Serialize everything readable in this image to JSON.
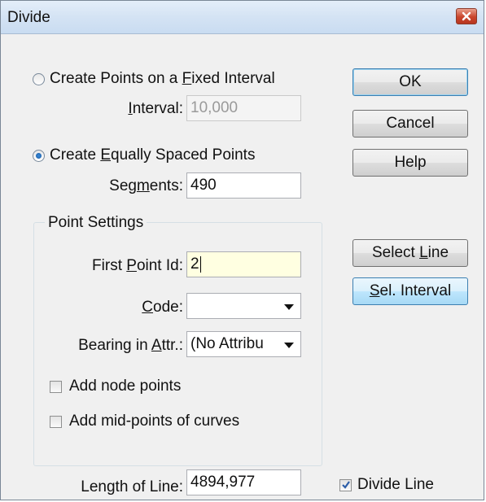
{
  "window": {
    "title": "Divide"
  },
  "fixed_interval": {
    "option_pre": "Create Points on a ",
    "option_key": "F",
    "option_post": "ixed  Interval",
    "interval_key": "I",
    "interval_label_post": "nterval:",
    "interval_value": "10,000",
    "selected": false
  },
  "equal_spacing": {
    "option_pre": "Create ",
    "option_key": "E",
    "option_post": "qually Spaced Points",
    "segments_pre": "Seg",
    "segments_key": "m",
    "segments_post": "ents:",
    "segments_value": "490",
    "selected": true
  },
  "point_settings": {
    "title": "Point Settings",
    "first_point_pre": "First ",
    "first_point_key": "P",
    "first_point_post": "oint Id:",
    "first_point_value": "2",
    "code_key": "C",
    "code_post": "ode:",
    "code_value": "",
    "bearing_pre": "Bearing in ",
    "bearing_key": "A",
    "bearing_post": "ttr.:",
    "bearing_value": "(No Attribu",
    "add_node_points": {
      "label": "Add node points",
      "checked": false
    },
    "add_mid_points": {
      "label": "Add mid-points of curves",
      "checked": false
    }
  },
  "length": {
    "label": "Length of Line:",
    "value": "4894,977"
  },
  "divide_line": {
    "label": "Divide Line",
    "checked": true
  },
  "buttons": {
    "ok": "OK",
    "cancel": "Cancel",
    "help": "Help",
    "select_line_pre": "Select ",
    "select_line_key": "L",
    "select_line_post": "ine",
    "sel_interval_key": "S",
    "sel_interval_post": "el. Interval"
  },
  "icons": {
    "close": "close-icon",
    "dropdown": "chevron-down-icon",
    "check": "checkmark-icon"
  },
  "colors": {
    "accent": "#3c7fb1",
    "close": "#c9452c",
    "focused_field": "#ffffe1"
  }
}
